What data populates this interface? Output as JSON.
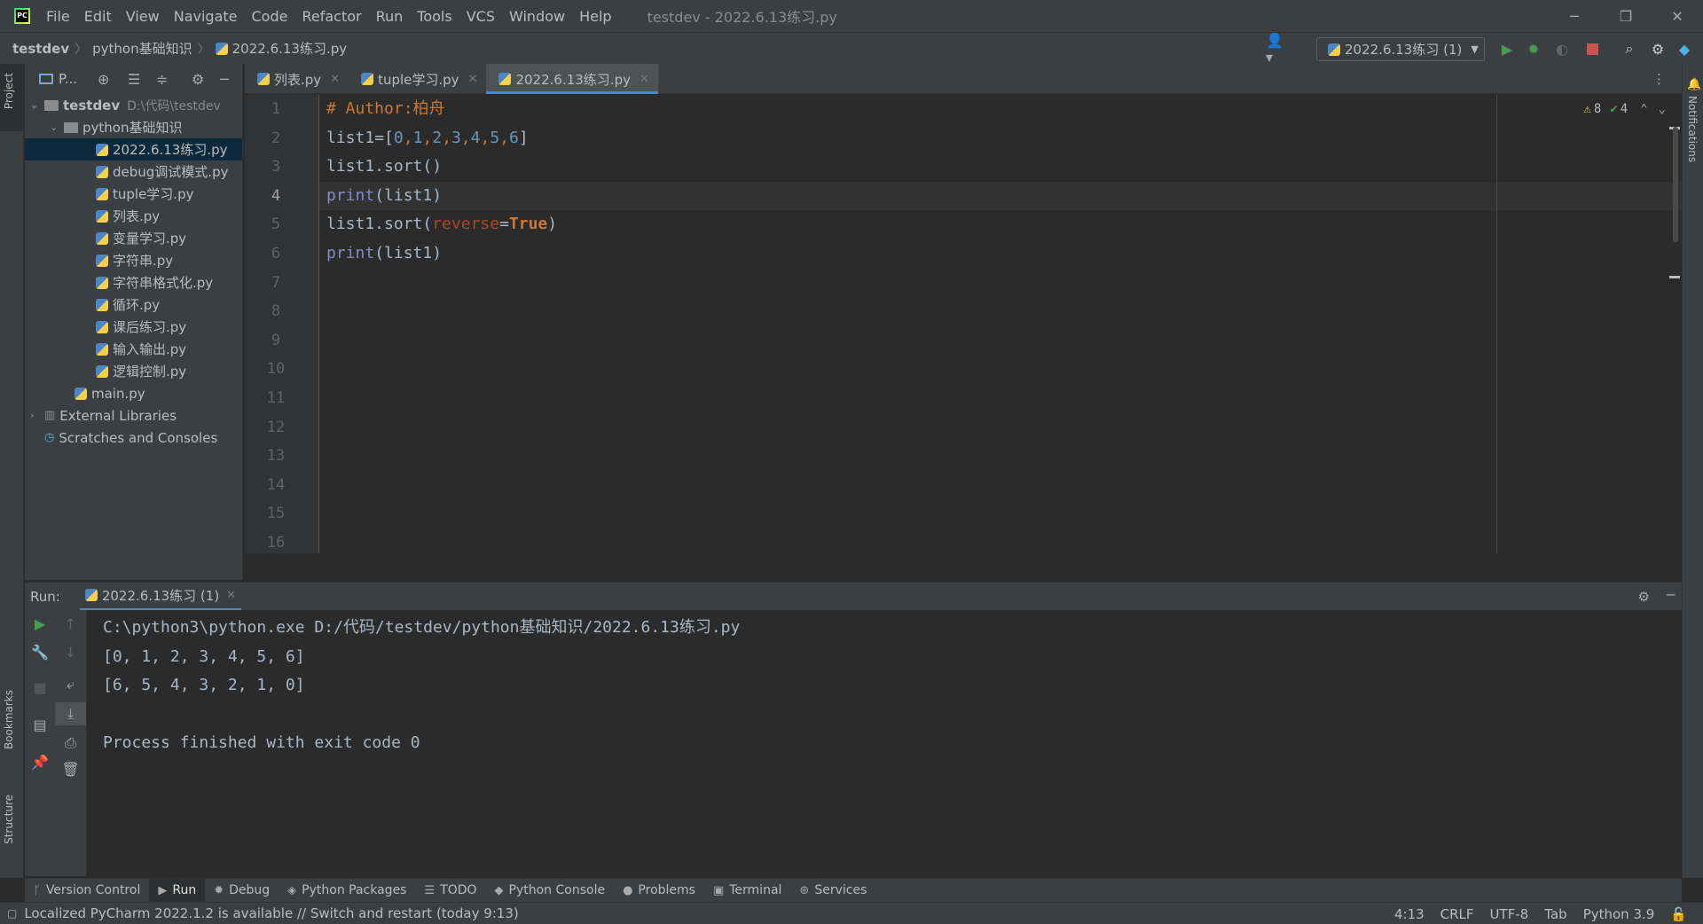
{
  "titlebar": {
    "menu": [
      "File",
      "Edit",
      "View",
      "Navigate",
      "Code",
      "Refactor",
      "Run",
      "Tools",
      "VCS",
      "Window",
      "Help"
    ],
    "window_title": "testdev - 2022.6.13练习.py"
  },
  "navbar": {
    "breadcrumb": [
      "testdev",
      "python基础知识",
      "2022.6.13练习.py"
    ],
    "run_config": "2022.6.13练习 (1)"
  },
  "sidebar_tabs": {
    "project": "Project",
    "bookmarks": "Bookmarks",
    "structure": "Structure",
    "notifications": "Notifications"
  },
  "project": {
    "header": "P...",
    "root": {
      "name": "testdev",
      "path": "D:\\代码\\testdev"
    },
    "folder": "python基础知识",
    "files": [
      "2022.6.13练习.py",
      "debug调试模式.py",
      "tuple学习.py",
      "列表.py",
      "变量学习.py",
      "字符串.py",
      "字符串格式化.py",
      "循环.py",
      "课后练习.py",
      "输入输出.py",
      "逻辑控制.py"
    ],
    "root_file": "main.py",
    "external": "External Libraries",
    "scratches": "Scratches and Consoles"
  },
  "editor": {
    "tabs": [
      "列表.py",
      "tuple学习.py",
      "2022.6.13练习.py"
    ],
    "active_tab": 2,
    "line_numbers": [
      "1",
      "2",
      "3",
      "4",
      "5",
      "6",
      "7",
      "8",
      "9",
      "10",
      "11",
      "12",
      "13",
      "14",
      "15",
      "16"
    ],
    "current_line": 4,
    "inspection": {
      "warnings": "8",
      "ok": "4"
    },
    "code": {
      "l1_comment": "# Author:柏舟",
      "l2_a": "list1",
      "l2_b": "=[",
      "l2_n": [
        "0",
        "1",
        "2",
        "3",
        "4",
        "5",
        "6"
      ],
      "l2_c": "]",
      "l3": "list1.sort()",
      "l4_fn": "print",
      "l4_rest": "(list1)",
      "l5_a": "list1.sort(",
      "l5_param": "reverse",
      "l5_eq": "=",
      "l5_bool": "True",
      "l5_end": ")",
      "l6_fn": "print",
      "l6_rest": "(list1)"
    }
  },
  "run": {
    "label": "Run:",
    "tab": "2022.6.13练习 (1)",
    "output": [
      "C:\\python3\\python.exe D:/代码/testdev/python基础知识/2022.6.13练习.py",
      "[0, 1, 2, 3, 4, 5, 6]",
      "[6, 5, 4, 3, 2, 1, 0]",
      "",
      "Process finished with exit code 0"
    ]
  },
  "tool_tabs": [
    "Version Control",
    "Run",
    "Debug",
    "Python Packages",
    "TODO",
    "Python Console",
    "Problems",
    "Terminal",
    "Services"
  ],
  "status": {
    "message": "Localized PyCharm 2022.1.2 is available // Switch and restart (today 9:13)",
    "position": "4:13",
    "line_sep": "CRLF",
    "encoding": "UTF-8",
    "indent": "Tab",
    "interpreter": "Python 3.9"
  },
  "colors": {
    "accent": "#4a88c7",
    "run_green": "#499c54",
    "stop_red": "#c75450",
    "comment": "#cc7832"
  }
}
